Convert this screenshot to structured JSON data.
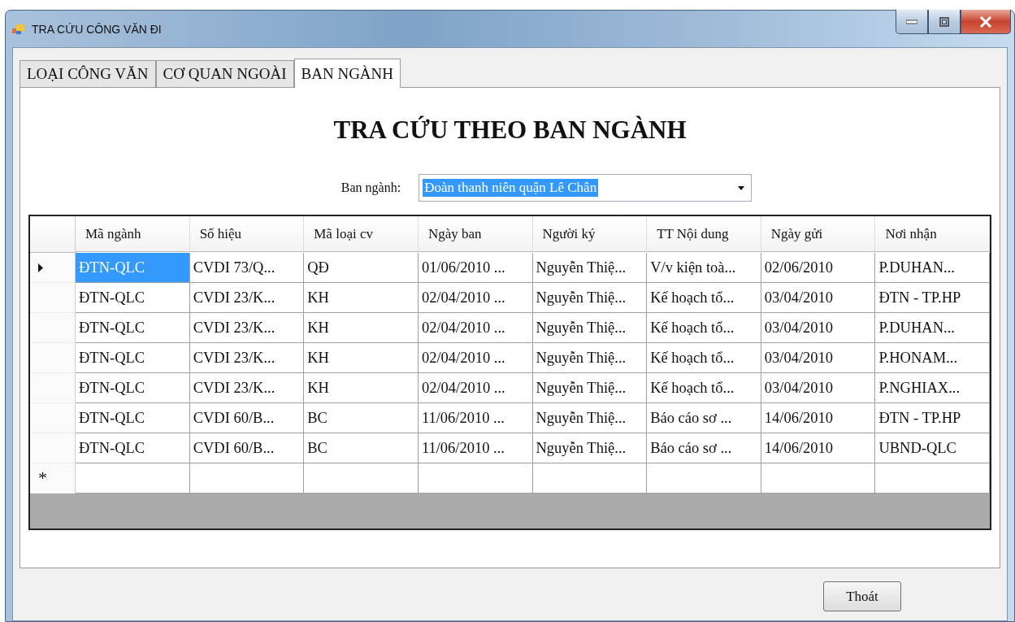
{
  "window": {
    "title": "TRA CỨU CÔNG VĂN ĐI"
  },
  "tabs": [
    {
      "label": "LOẠI CÔNG VĂN",
      "selected": false
    },
    {
      "label": "CƠ QUAN NGOÀI",
      "selected": false
    },
    {
      "label": "BAN NGÀNH",
      "selected": true
    }
  ],
  "heading": "TRA CỨU THEO BAN NGÀNH",
  "filter": {
    "label": "Ban ngành:",
    "value": "Đoàn thanh niên quận Lê Chân"
  },
  "table": {
    "columns": [
      "Mã ngành",
      "Số hiệu",
      "Mã loại cv",
      "Ngày ban",
      "Người ký",
      "TT Nội dung",
      "Ngày gửi",
      "Nơi nhận"
    ],
    "rows": [
      {
        "selected": true,
        "cells": [
          "ĐTN-QLC",
          "CVDI 73/Q...",
          "QĐ",
          "01/06/2010 ...",
          "Nguyễn Thiệ...",
          "V/v kiện toà...",
          "02/06/2010",
          "P.DUHAN..."
        ]
      },
      {
        "selected": false,
        "cells": [
          "ĐTN-QLC",
          "CVDI 23/K...",
          "KH",
          "02/04/2010 ...",
          "Nguyễn Thiệ...",
          "Kế hoạch tổ...",
          "03/04/2010",
          "ĐTN - TP.HP"
        ]
      },
      {
        "selected": false,
        "cells": [
          "ĐTN-QLC",
          "CVDI 23/K...",
          "KH",
          "02/04/2010 ...",
          "Nguyễn Thiệ...",
          "Kế hoạch tổ...",
          "03/04/2010",
          "P.DUHAN..."
        ]
      },
      {
        "selected": false,
        "cells": [
          "ĐTN-QLC",
          "CVDI 23/K...",
          "KH",
          "02/04/2010 ...",
          "Nguyễn Thiệ...",
          "Kế hoạch tổ...",
          "03/04/2010",
          "P.HONAM..."
        ]
      },
      {
        "selected": false,
        "cells": [
          "ĐTN-QLC",
          "CVDI 23/K...",
          "KH",
          "02/04/2010 ...",
          "Nguyễn Thiệ...",
          "Kế hoạch tổ...",
          "03/04/2010",
          "P.NGHIAX..."
        ]
      },
      {
        "selected": false,
        "cells": [
          "ĐTN-QLC",
          "CVDI 60/B...",
          "BC",
          "11/06/2010 ...",
          "Nguyễn Thiệ...",
          "Báo cáo sơ ...",
          "14/06/2010",
          "ĐTN - TP.HP"
        ]
      },
      {
        "selected": false,
        "cells": [
          "ĐTN-QLC",
          "CVDI 60/B...",
          "BC",
          "11/06/2010 ...",
          "Nguyễn Thiệ...",
          "Báo cáo sơ ...",
          "14/06/2010",
          "UBND-QLC"
        ]
      }
    ],
    "new_row_marker": "*"
  },
  "buttons": [
    "Thoát"
  ]
}
